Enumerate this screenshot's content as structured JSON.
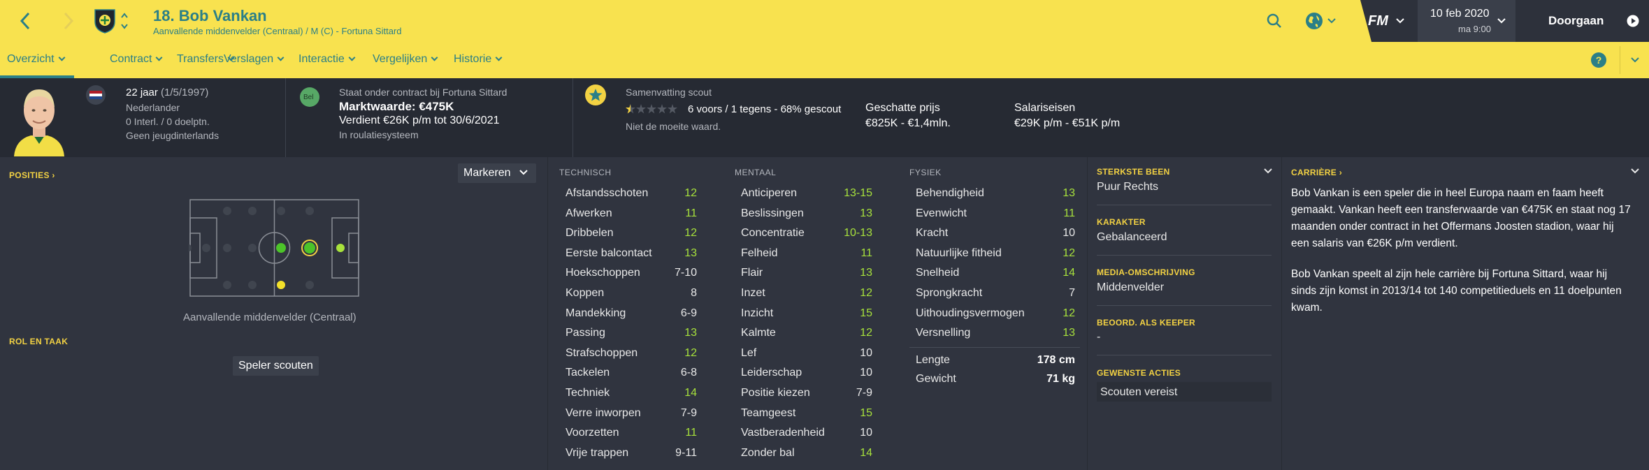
{
  "header": {
    "player_title": "18. Bob Vankan",
    "subtitle": "Aanvallende middenvelder (Centraal) / M (C) - Fortuna Sittard",
    "date": "10 feb 2020",
    "time": "ma 9:00",
    "continue_label": "Doorgaan",
    "fm_logo": "FM"
  },
  "nav": {
    "items": [
      "Overzicht",
      "Contract",
      "Transfers",
      "Verslagen",
      "Interactie",
      "Vergelijken",
      "Historie"
    ],
    "active": "Overzicht"
  },
  "info": {
    "age": "22 jaar",
    "birth": "(1/5/1997)",
    "nationality": "Nederlander",
    "caps": "0 Interl. / 0 doelptn.",
    "youth": "Geen jeugdinterlands",
    "contract_badge": "Bel",
    "contract_title": "Staat onder contract bij Fortuna Sittard",
    "market_value": "Marktwaarde: €475K",
    "wage": "Verdient €26K p/m tot 30/6/2021",
    "squad_status": "In roulatiesysteem",
    "scout_summary_label": "Samenvatting scout",
    "scout_summary": "6 voors / 1 tegens - 68% gescout",
    "scout_verdict": "Niet de moeite waard.",
    "est_price_label": "Geschatte prijs",
    "est_price": "€825K - €1,4mln.",
    "wage_demand_label": "Salariseisen",
    "wage_demand": "€29K p/m - €51K p/m",
    "star_rating": 0.5,
    "star_max": 5
  },
  "positions": {
    "heading": "POSITIES",
    "mark_label": "Markeren",
    "position_label": "Aanvallende middenvelder (Centraal)",
    "role_heading": "ROL EN TAAK",
    "scout_button": "Speler scouten"
  },
  "columns": {
    "technical": "TECHNISCH",
    "mental": "MENTAAL",
    "physical": "FYSIEK"
  },
  "technical": [
    {
      "name": "Afstandsschoten",
      "value": "12"
    },
    {
      "name": "Afwerken",
      "value": "11"
    },
    {
      "name": "Dribbelen",
      "value": "12"
    },
    {
      "name": "Eerste balcontact",
      "value": "13"
    },
    {
      "name": "Hoekschoppen",
      "value": "7-10"
    },
    {
      "name": "Koppen",
      "value": "8"
    },
    {
      "name": "Mandekking",
      "value": "6-9"
    },
    {
      "name": "Passing",
      "value": "13"
    },
    {
      "name": "Strafschoppen",
      "value": "12"
    },
    {
      "name": "Tackelen",
      "value": "6-8"
    },
    {
      "name": "Techniek",
      "value": "14"
    },
    {
      "name": "Verre inworpen",
      "value": "7-9"
    },
    {
      "name": "Voorzetten",
      "value": "11"
    },
    {
      "name": "Vrije trappen",
      "value": "9-11"
    }
  ],
  "mental": [
    {
      "name": "Anticiperen",
      "value": "13-15"
    },
    {
      "name": "Beslissingen",
      "value": "13"
    },
    {
      "name": "Concentratie",
      "value": "10-13"
    },
    {
      "name": "Felheid",
      "value": "11"
    },
    {
      "name": "Flair",
      "value": "13"
    },
    {
      "name": "Inzet",
      "value": "12"
    },
    {
      "name": "Inzicht",
      "value": "15"
    },
    {
      "name": "Kalmte",
      "value": "12"
    },
    {
      "name": "Lef",
      "value": "10"
    },
    {
      "name": "Leiderschap",
      "value": "10"
    },
    {
      "name": "Positie kiezen",
      "value": "7-9"
    },
    {
      "name": "Teamgeest",
      "value": "15"
    },
    {
      "name": "Vastberadenheid",
      "value": "10"
    },
    {
      "name": "Zonder bal",
      "value": "14"
    }
  ],
  "physical": [
    {
      "name": "Behendigheid",
      "value": "13"
    },
    {
      "name": "Evenwicht",
      "value": "11"
    },
    {
      "name": "Kracht",
      "value": "10"
    },
    {
      "name": "Natuurlijke fitheid",
      "value": "12"
    },
    {
      "name": "Snelheid",
      "value": "14"
    },
    {
      "name": "Sprongkracht",
      "value": "7"
    },
    {
      "name": "Uithoudingsvermogen",
      "value": "12"
    },
    {
      "name": "Versnelling",
      "value": "13"
    }
  ],
  "physical_extra": [
    {
      "name": "Lengte",
      "value": "178 cm"
    },
    {
      "name": "Gewicht",
      "value": "71 kg"
    }
  ],
  "side": {
    "foot_heading": "STERKSTE BEEN",
    "foot": "Puur Rechts",
    "character_heading": "KARAKTER",
    "character": "Gebalanceerd",
    "media_heading": "MEDIA-OMSCHRIJVING",
    "media": "Middenvelder",
    "keeper_heading": "BEOORD. ALS KEEPER",
    "keeper": "-",
    "actions_heading": "GEWENSTE ACTIES",
    "action": "Scouten vereist"
  },
  "career": {
    "heading": "CARRIÈRE",
    "para1": "Bob Vankan is een speler die in heel Europa naam en faam heeft gemaakt. Vankan heeft een transferwaarde van €475K en staat nog 17 maanden onder contract in het Offermans Joosten stadion, waar hij een salaris van €26K p/m verdient.",
    "para2": "Bob Vankan speelt al zijn hele carrière bij Fortuna Sittard, waar hij sinds zijn komst in 2013/14 tot 140 competitieduels en 11 doelpunten kwam."
  },
  "colors": {
    "yellow": "#f8e24f",
    "teal": "#2b7f87",
    "green": "#a8e23c",
    "dark": "#30343f",
    "accent": "#f3d243"
  },
  "icons": [
    "back-icon",
    "forward-icon",
    "club-badge-icon",
    "search-icon",
    "globe-icon",
    "chevron-down-icon",
    "help-icon",
    "star-icon",
    "flag-icon"
  ]
}
